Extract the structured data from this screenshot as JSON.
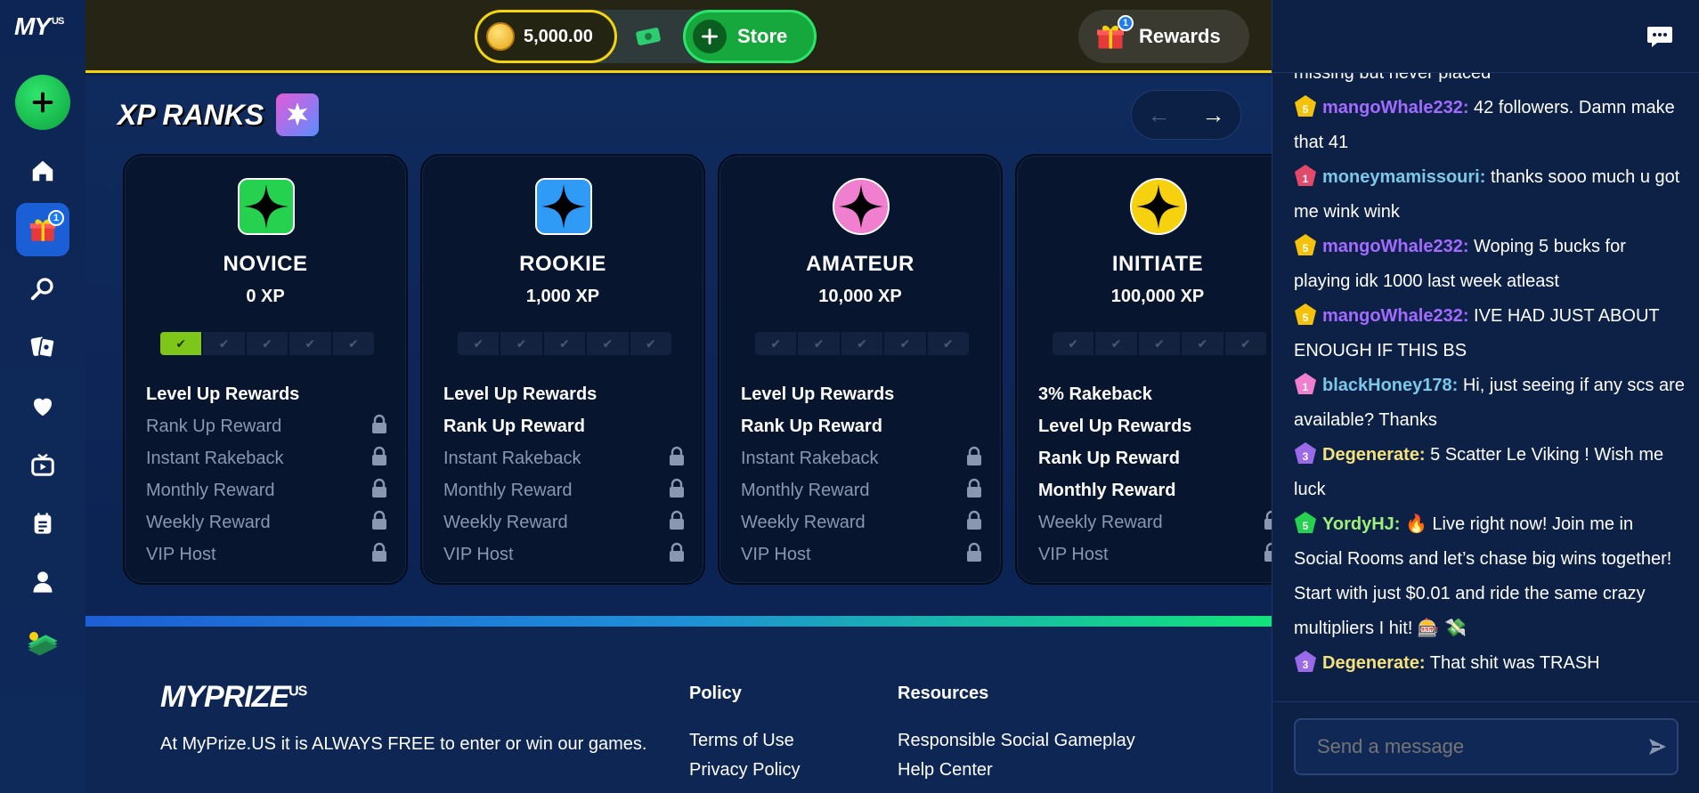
{
  "sidebar": {
    "logo": "MY",
    "logo_suffix": "US",
    "gift_badge": "1"
  },
  "topbar": {
    "balance": "5,000.00",
    "store_label": "Store",
    "rewards_label": "Rewards",
    "rewards_badge": "1"
  },
  "main": {
    "title": "XP RANKS",
    "prev_arrow": "←",
    "next_arrow": "→",
    "ranks": [
      {
        "name": "NOVICE",
        "xp": "0 XP",
        "color": "#25d14f",
        "icon_shape": "square",
        "progress_filled": 1,
        "perks": [
          {
            "label": "Level Up Rewards",
            "unlocked": true
          },
          {
            "label": "Rank Up Reward",
            "unlocked": false
          },
          {
            "label": "Instant Rakeback",
            "unlocked": false
          },
          {
            "label": "Monthly Reward",
            "unlocked": false
          },
          {
            "label": "Weekly Reward",
            "unlocked": false
          },
          {
            "label": "VIP Host",
            "unlocked": false
          }
        ]
      },
      {
        "name": "ROOKIE",
        "xp": "1,000 XP",
        "color": "#2f9bf7",
        "icon_shape": "square",
        "progress_filled": 0,
        "perks": [
          {
            "label": "Level Up Rewards",
            "unlocked": true
          },
          {
            "label": "Rank Up Reward",
            "unlocked": true
          },
          {
            "label": "Instant Rakeback",
            "unlocked": false
          },
          {
            "label": "Monthly Reward",
            "unlocked": false
          },
          {
            "label": "Weekly Reward",
            "unlocked": false
          },
          {
            "label": "VIP Host",
            "unlocked": false
          }
        ]
      },
      {
        "name": "AMATEUR",
        "xp": "10,000 XP",
        "color": "#f07fd0",
        "icon_shape": "circle",
        "progress_filled": 0,
        "perks": [
          {
            "label": "Level Up Rewards",
            "unlocked": true
          },
          {
            "label": "Rank Up Reward",
            "unlocked": true
          },
          {
            "label": "Instant Rakeback",
            "unlocked": false
          },
          {
            "label": "Monthly Reward",
            "unlocked": false
          },
          {
            "label": "Weekly Reward",
            "unlocked": false
          },
          {
            "label": "VIP Host",
            "unlocked": false
          }
        ]
      },
      {
        "name": "INITIATE",
        "xp": "100,000 XP",
        "color": "#f6d10f",
        "icon_shape": "circle",
        "progress_filled": 0,
        "perks": [
          {
            "label": "3% Rakeback",
            "unlocked": true
          },
          {
            "label": "Level Up Rewards",
            "unlocked": true
          },
          {
            "label": "Rank Up Reward",
            "unlocked": true
          },
          {
            "label": "Monthly Reward",
            "unlocked": true
          },
          {
            "label": "Weekly Reward",
            "unlocked": false
          },
          {
            "label": "VIP Host",
            "unlocked": false
          }
        ]
      }
    ]
  },
  "footer": {
    "logo": "MYPRIZE",
    "logo_suffix": "US",
    "tagline": "At MyPrize.US it is ALWAYS FREE to enter or win our games.",
    "policy": {
      "heading": "Policy",
      "links": [
        "Terms of Use",
        "Privacy Policy"
      ]
    },
    "resources": {
      "heading": "Resources",
      "links": [
        "Responsible Social Gameplay",
        "Help Center"
      ]
    }
  },
  "chat": {
    "placeholder": "Send a message",
    "messages": [
      {
        "user": "",
        "text": "missing but never placed",
        "color": "#ffffff",
        "avatar_color": "",
        "level": ""
      },
      {
        "user": "mangoWhale232:",
        "text": " 42 followers. Damn make that 41",
        "color": "#a36bff",
        "avatar_color": "#f4c20d",
        "level": "5"
      },
      {
        "user": "moneymamissouri:",
        "text": " thanks sooo much u got me wink wink",
        "color": "#7cc8e8",
        "avatar_color": "#e34a6a",
        "level": "1"
      },
      {
        "user": "mangoWhale232:",
        "text": " Woping 5 bucks for playing idk 1000 last week atleast",
        "color": "#a36bff",
        "avatar_color": "#f4c20d",
        "level": "5"
      },
      {
        "user": "mangoWhale232:",
        "text": " IVE HAD JUST ABOUT ENOUGH IF THIS BS",
        "color": "#a36bff",
        "avatar_color": "#f4c20d",
        "level": "5"
      },
      {
        "user": "blackHoney178:",
        "text": " Hi, just seeing if any scs are available? Thanks",
        "color": "#7cc8e8",
        "avatar_color": "#f07fd0",
        "level": "1"
      },
      {
        "user": "Degenerate:",
        "text": " 5 Scatter Le Viking ! Wish me luck",
        "color": "#f6e27a",
        "avatar_color": "#9b6ae8",
        "level": "3"
      },
      {
        "user": "YordyHJ:",
        "text": " 🔥 Live right now! Join me in Social Rooms and let’s chase big wins together! Start with just $0.01 and ride the same crazy multipliers I hit! 🎰 💸",
        "color": "#9ef07a",
        "avatar_color": "#25d14f",
        "level": "5"
      },
      {
        "user": "Degenerate:",
        "text": " That shit was TRASH",
        "color": "#f6e27a",
        "avatar_color": "#9b6ae8",
        "level": "3"
      }
    ]
  }
}
